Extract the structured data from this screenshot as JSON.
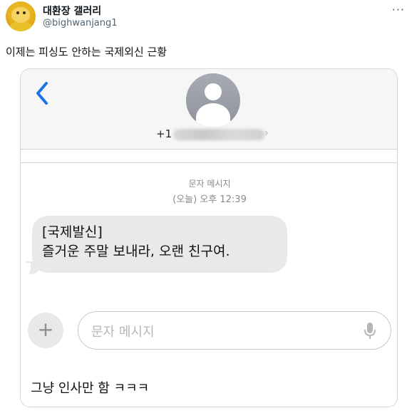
{
  "tweet": {
    "display_name": "대환장 갤러리",
    "handle": "@bighwanjang1",
    "more": "···",
    "text": "이제는 피싱도 안하는 국제외신 근황"
  },
  "sms": {
    "phone_prefix": "+1",
    "chevron": "›",
    "message_kind": "문자 메시지",
    "timestamp": "(오늘) 오후 12:39",
    "bubble_line1": "[국제발신]",
    "bubble_line2": "즐거운 주말 보내라, 오랜 친구여.",
    "plus": "+",
    "compose_placeholder": "문자 메시지",
    "caption": "그냥 인사만 함 ㅋㅋㅋ"
  },
  "colors": {
    "ios_blue": "#1a73e8",
    "bubble_gray": "#e9e9eb",
    "border": "#cfd9de"
  }
}
